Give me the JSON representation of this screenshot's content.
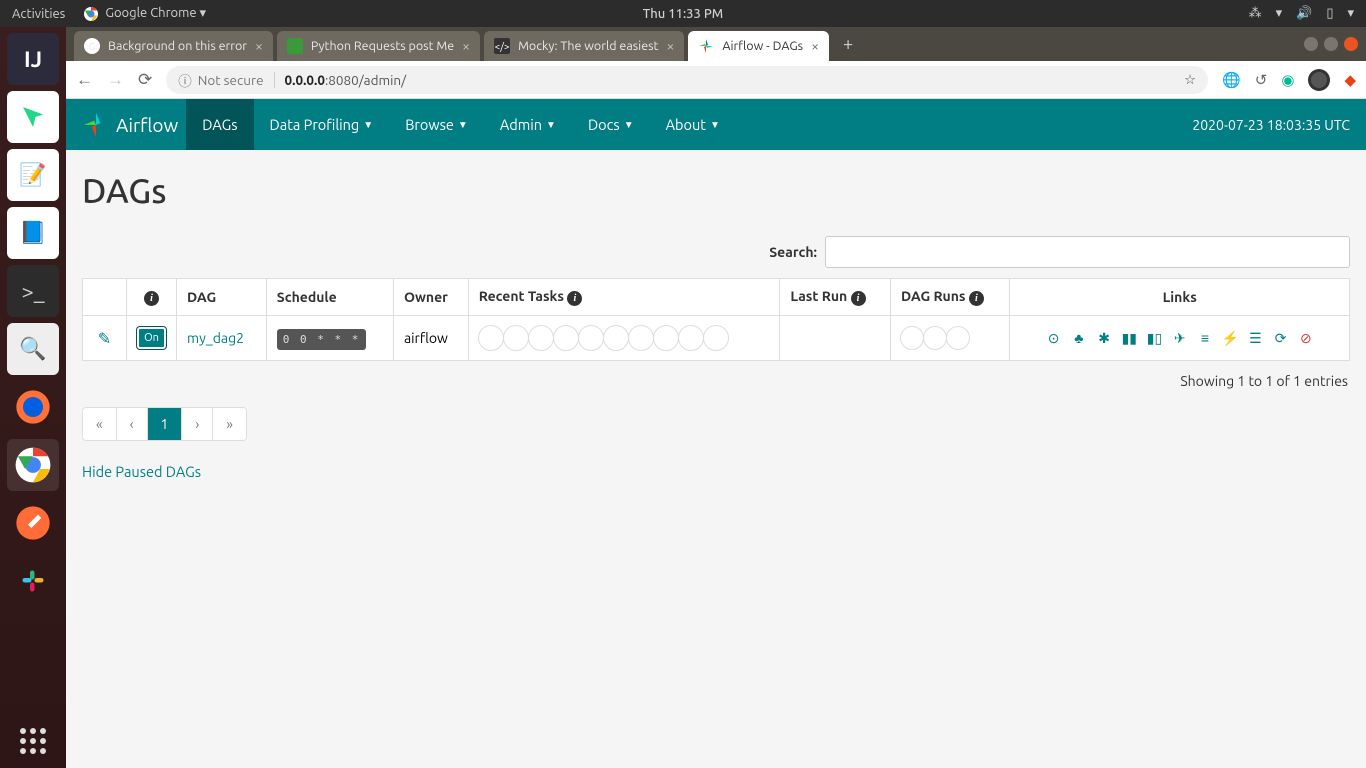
{
  "ubuntu": {
    "activities": "Activities",
    "app": "Google Chrome ▾",
    "clock": "Thu 11:33 PM"
  },
  "tabs": [
    {
      "title": "Background on this error"
    },
    {
      "title": "Python Requests post Me"
    },
    {
      "title": "Mocky: The world easiest"
    },
    {
      "title": "Airflow - DAGs"
    }
  ],
  "address": {
    "not_secure": "Not secure",
    "url_host": "0.0.0.0",
    "url_rest": ":8080/admin/"
  },
  "nav": {
    "brand": "Airflow",
    "items": [
      "DAGs",
      "Data Profiling",
      "Browse",
      "Admin",
      "Docs",
      "About"
    ],
    "timestamp": "2020-07-23 18:03:35 UTC"
  },
  "page": {
    "heading": "DAGs",
    "search_label": "Search:",
    "columns": {
      "dag": "DAG",
      "schedule": "Schedule",
      "owner": "Owner",
      "recent": "Recent Tasks",
      "last": "Last Run",
      "runs": "DAG Runs",
      "links": "Links"
    },
    "row": {
      "toggle": "On",
      "name": "my_dag2",
      "schedule": "0 0 * * *",
      "owner": "airflow"
    },
    "footer": "Showing 1 to 1 of 1 entries",
    "pager": {
      "first": "«",
      "prev": "‹",
      "page": "1",
      "next": "›",
      "last": "»"
    },
    "hide": "Hide Paused DAGs"
  }
}
